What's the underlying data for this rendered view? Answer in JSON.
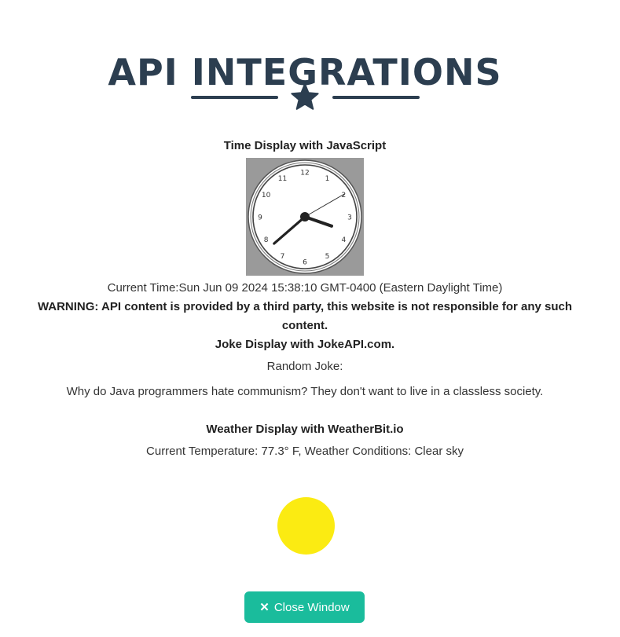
{
  "page": {
    "title": "API INTEGRATIONS"
  },
  "time_section": {
    "heading": "Time Display with JavaScript",
    "clock": {
      "hour": 15,
      "minute": 38,
      "second": 10,
      "numerals": [
        "12",
        "1",
        "2",
        "3",
        "4",
        "5",
        "6",
        "7",
        "8",
        "9",
        "10",
        "11"
      ]
    },
    "current_time": "Current Time:Sun Jun 09 2024 15:38:10 GMT-0400 (Eastern Daylight Time)"
  },
  "warning": "WARNING: API content is provided by a third party, this website is not responsible for any such content.",
  "joke_section": {
    "heading": "Joke Display with JokeAPI.com.",
    "label": "Random Joke:",
    "text": "Why do Java programmers hate communism? They don't want to live in a classless society."
  },
  "weather_section": {
    "heading": "Weather Display with WeatherBit.io",
    "text": "Current Temperature: 77.3° F, Weather Conditions: Clear sky"
  },
  "close_button": {
    "icon": "close-icon",
    "label": "Close Window"
  },
  "colors": {
    "title": "#2c3e50",
    "accent": "#1abc9c",
    "sun": "#fbeb12"
  }
}
